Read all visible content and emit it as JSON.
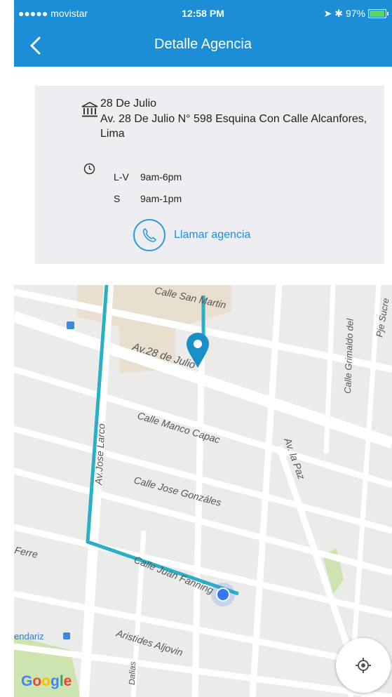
{
  "status_bar": {
    "carrier": "●●●●● movistar",
    "time": "12:58 PM",
    "battery": "97%",
    "battery_level": 0.97
  },
  "nav": {
    "title": "Detalle Agencia",
    "back_icon": "chevron-left-icon"
  },
  "agency": {
    "name": "28 De Julio",
    "address": "Av. 28 De Julio N° 598 Esquina Con Calle Alcanfores, Lima",
    "hours": [
      {
        "day": "L-V",
        "time": "9am-6pm"
      },
      {
        "day": "S",
        "time": "9am-1pm"
      }
    ],
    "call_label": "Llamar agencia"
  },
  "map": {
    "streets": {
      "san_martin": "Calle San Martin",
      "veintiocho_julio": "Av.28 de Julio",
      "manco_capac": "Calle Manco Capac",
      "jose_gonzales": "Calle Jose Gonzáles",
      "juan_fanning": "Calle Juan Fanning",
      "aristides": "Aristides Aljovin",
      "jose_larco": "Av.Jose Larco",
      "la_paz": "Av. la Paz",
      "grimaldo": "Calle Grimaldo del",
      "sucre": "Pje Sucre",
      "ferre": "Ferre",
      "dalias": "Dalias",
      "endariz": "endariz"
    },
    "attribution": "Google",
    "colors": {
      "route": "#2ab0c6",
      "marker": "#1a8fc7",
      "user_dot": "#3478f6",
      "road": "#ffffff",
      "background": "#ebebea"
    }
  }
}
